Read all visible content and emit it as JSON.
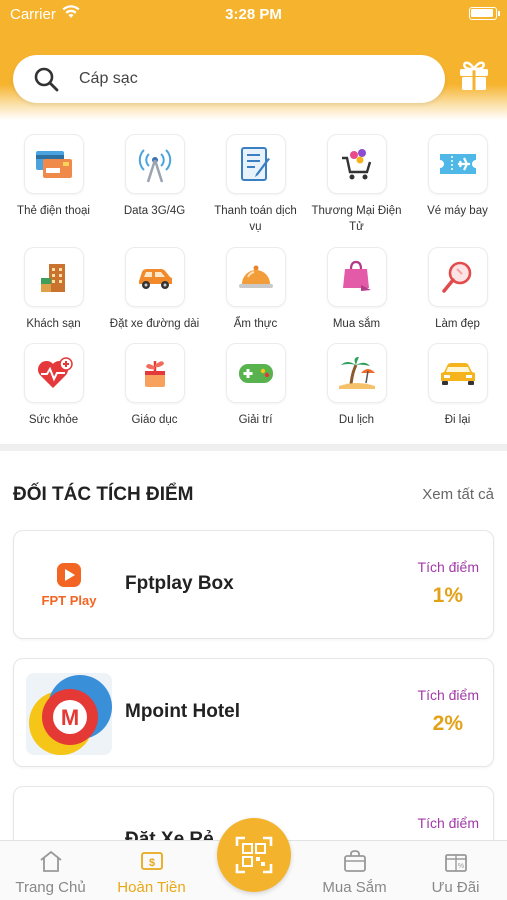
{
  "status_bar": {
    "carrier": "Carrier",
    "time": "3:28 PM"
  },
  "search": {
    "placeholder": "Cáp sạc"
  },
  "categories": [
    {
      "label": "Thẻ điện thoại",
      "icon": "phone-card-icon"
    },
    {
      "label": "Data 3G/4G",
      "icon": "antenna-icon"
    },
    {
      "label": "Thanh toán dịch vụ",
      "icon": "bill-payment-icon"
    },
    {
      "label": "Thương Mại Điện Tử",
      "icon": "shopping-cart-icon"
    },
    {
      "label": "Vé máy bay",
      "icon": "plane-ticket-icon"
    },
    {
      "label": "Khách sạn",
      "icon": "hotel-icon"
    },
    {
      "label": "Đặt xe đường dài",
      "icon": "car-icon"
    },
    {
      "label": "Ẩm thực",
      "icon": "food-cloche-icon"
    },
    {
      "label": "Mua sắm",
      "icon": "shopping-bag-icon"
    },
    {
      "label": "Làm đẹp",
      "icon": "mirror-icon"
    },
    {
      "label": "Sức khỏe",
      "icon": "health-heart-icon"
    },
    {
      "label": "Giáo dục",
      "icon": "education-plant-icon"
    },
    {
      "label": "Giải trí",
      "icon": "gamepad-icon"
    },
    {
      "label": "Du lịch",
      "icon": "beach-icon"
    },
    {
      "label": "Đi lại",
      "icon": "taxi-icon"
    }
  ],
  "partners_section": {
    "title": "ĐỐI TÁC TÍCH ĐIỂM",
    "see_all": "Xem tất cả"
  },
  "partners": [
    {
      "name": "Fptplay Box",
      "points_label": "Tích điểm",
      "points": "1%",
      "logo_text": "FPT Play"
    },
    {
      "name": "Mpoint Hotel",
      "points_label": "Tích điểm",
      "points": "2%",
      "logo_text": "M"
    },
    {
      "name": "Đặt Xe Rẻ",
      "points_label": "Tích điểm",
      "points": ""
    }
  ],
  "tabs": [
    {
      "label": "Trang Chủ",
      "icon": "home-icon",
      "active": false
    },
    {
      "label": "Hoàn Tiền",
      "icon": "cashback-icon",
      "active": true
    },
    {
      "label": "Mua Sắm",
      "icon": "shopping-icon",
      "active": false
    },
    {
      "label": "Ưu Đãi",
      "icon": "voucher-icon",
      "active": false
    }
  ],
  "colors": {
    "brand": "#f6b32d",
    "points_label": "#a13ba8",
    "points_value": "#e3a117"
  }
}
